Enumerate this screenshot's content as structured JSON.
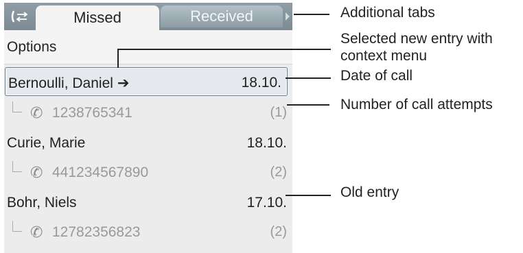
{
  "tabs": {
    "switch_icon": "tab-switch-icon",
    "active_label": "Missed",
    "inactive_label": "Received",
    "more_icon": "chevron-right-icon"
  },
  "options_label": "Options",
  "entries": [
    {
      "name": "Bernoulli, Daniel",
      "arrow": "➔",
      "date": "18.10.",
      "number": "1238765341",
      "attempts": "(1)",
      "selected": true
    },
    {
      "name": "Curie, Marie",
      "date": "18.10.",
      "number": "441234567890",
      "attempts": "(2)",
      "selected": false
    },
    {
      "name": "Bohr, Niels",
      "date": "17.10.",
      "number": "12782356823",
      "attempts": "(2)",
      "selected": false
    }
  ],
  "handset_icon": "handset-icon",
  "annotations": {
    "additional_tabs": "Additional tabs",
    "selected_entry_line1": "Selected new entry with",
    "selected_entry_line2": "context menu",
    "date_of_call": "Date of call",
    "call_attempts": "Number of call attempts",
    "old_entry": "Old entry"
  }
}
